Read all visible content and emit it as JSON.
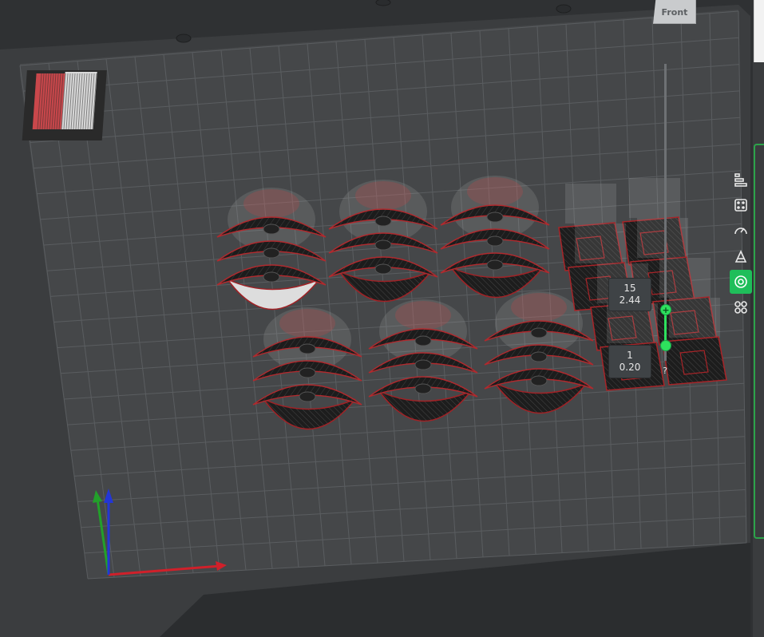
{
  "viewport": {
    "view_cube_label": "Front",
    "bed_color": "#454749",
    "grid_color": "#6b6e70"
  },
  "layer_slider": {
    "upper": {
      "layer": "15",
      "height": "2.44"
    },
    "lower": {
      "layer": "1",
      "height": "0.20"
    },
    "help_label": "?",
    "add_label": "+",
    "accent": "#2ee05d"
  },
  "toolbar": {
    "items": [
      {
        "name": "layers-icon"
      },
      {
        "name": "arrange-icon"
      },
      {
        "name": "speed-gauge-icon"
      },
      {
        "name": "paint-support-icon"
      },
      {
        "name": "preview-icon",
        "active": true
      },
      {
        "name": "multi-object-icon"
      }
    ],
    "active_color": "#1fbe5a"
  },
  "axes": {
    "x_color": "#d0202a",
    "y_color": "#22a02a",
    "z_color": "#2336d6"
  }
}
